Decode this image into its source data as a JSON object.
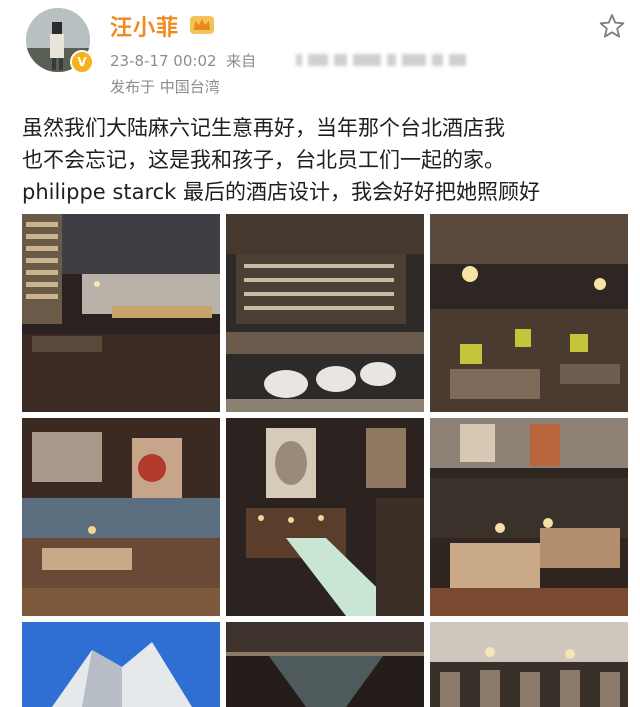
{
  "post": {
    "username": "汪小菲",
    "timestamp": "23-8-17 00:02",
    "source_label": "来自",
    "location": "发布于 中国台湾",
    "text_lines": [
      "虽然我们大陆麻六记生意再好，当年那个台北酒店我",
      "也不会忘记，这是我和孩子，台北员工们一起的家。",
      "philippe starck 最后的酒店设计，我会好好把她照顾好"
    ]
  },
  "icons": {
    "verified": "verified-badge-icon",
    "crown": "crown-icon",
    "favorite": "star-icon"
  },
  "colors": {
    "username": "#f08a1c",
    "meta": "#8d8d8d",
    "verified": "#f6b21a"
  },
  "photos_count": 9
}
